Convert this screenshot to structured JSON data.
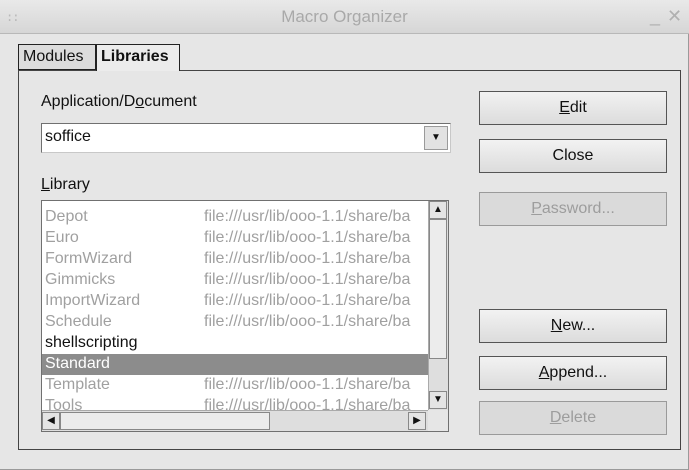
{
  "window": {
    "title": "Macro Organizer"
  },
  "tabs": [
    {
      "label": "Modules"
    },
    {
      "label": "Libraries"
    }
  ],
  "app_label_pre": "Application/D",
  "app_label_key": "o",
  "app_label_post": "cument",
  "app_value": "soffice",
  "library_label_key": "L",
  "library_label_rest": "ibrary",
  "libraries": [
    {
      "name": "Depot",
      "path": "file:///usr/lib/ooo-1.1/share/ba"
    },
    {
      "name": "Euro",
      "path": "file:///usr/lib/ooo-1.1/share/ba"
    },
    {
      "name": "FormWizard",
      "path": "file:///usr/lib/ooo-1.1/share/ba"
    },
    {
      "name": "Gimmicks",
      "path": "file:///usr/lib/ooo-1.1/share/ba"
    },
    {
      "name": "ImportWizard",
      "path": "file:///usr/lib/ooo-1.1/share/ba"
    },
    {
      "name": "Schedule",
      "path": "file:///usr/lib/ooo-1.1/share/ba"
    },
    {
      "name": "shellscripting",
      "path": ""
    },
    {
      "name": "Standard",
      "path": ""
    },
    {
      "name": "Template",
      "path": "file:///usr/lib/ooo-1.1/share/ba"
    },
    {
      "name": "Tools",
      "path": "file:///usr/lib/ooo-1.1/share/ba"
    }
  ],
  "buttons": {
    "edit_key": "E",
    "edit_rest": "dit",
    "close": "Close",
    "password_key": "P",
    "password_rest": "assword...",
    "new_key": "N",
    "new_rest": "ew...",
    "append_key": "A",
    "append_rest": "ppend...",
    "delete_key": "D",
    "delete_rest": "elete"
  }
}
